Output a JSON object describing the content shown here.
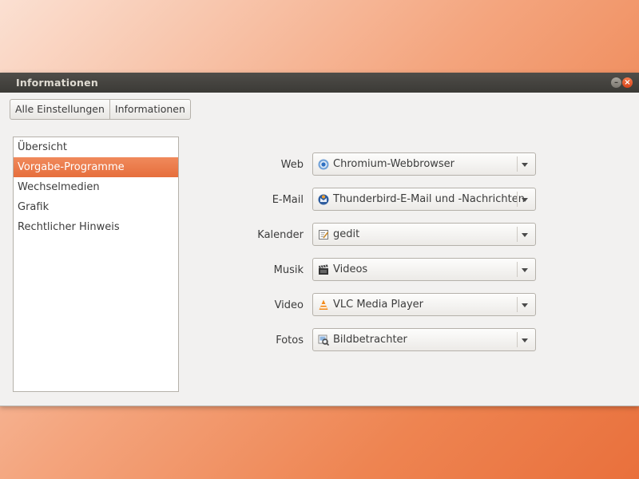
{
  "window": {
    "title": "Informationen"
  },
  "breadcrumb": {
    "items": [
      "Alle Einstellungen",
      "Informationen"
    ]
  },
  "sidebar": {
    "items": [
      {
        "label": "Übersicht"
      },
      {
        "label": "Vorgabe-Programme",
        "selected": true
      },
      {
        "label": "Wechselmedien"
      },
      {
        "label": "Grafik"
      },
      {
        "label": "Rechtlicher Hinweis"
      }
    ]
  },
  "defaults": {
    "rows": [
      {
        "label": "Web",
        "value": "Chromium-Webbrowser",
        "icon": "chromium-icon"
      },
      {
        "label": "E-Mail",
        "value": "Thunderbird-E-Mail und -Nachrichten",
        "icon": "thunderbird-icon"
      },
      {
        "label": "Kalender",
        "value": "gedit",
        "icon": "gedit-icon"
      },
      {
        "label": "Musik",
        "value": "Videos",
        "icon": "videos-icon"
      },
      {
        "label": "Video",
        "value": "VLC Media Player",
        "icon": "vlc-icon"
      },
      {
        "label": "Fotos",
        "value": "Bildbetrachter",
        "icon": "image-viewer-icon"
      }
    ]
  },
  "colors": {
    "accent": "#e66e3c",
    "titlebar": "#3b3a36",
    "window_bg": "#f2f1f0"
  }
}
